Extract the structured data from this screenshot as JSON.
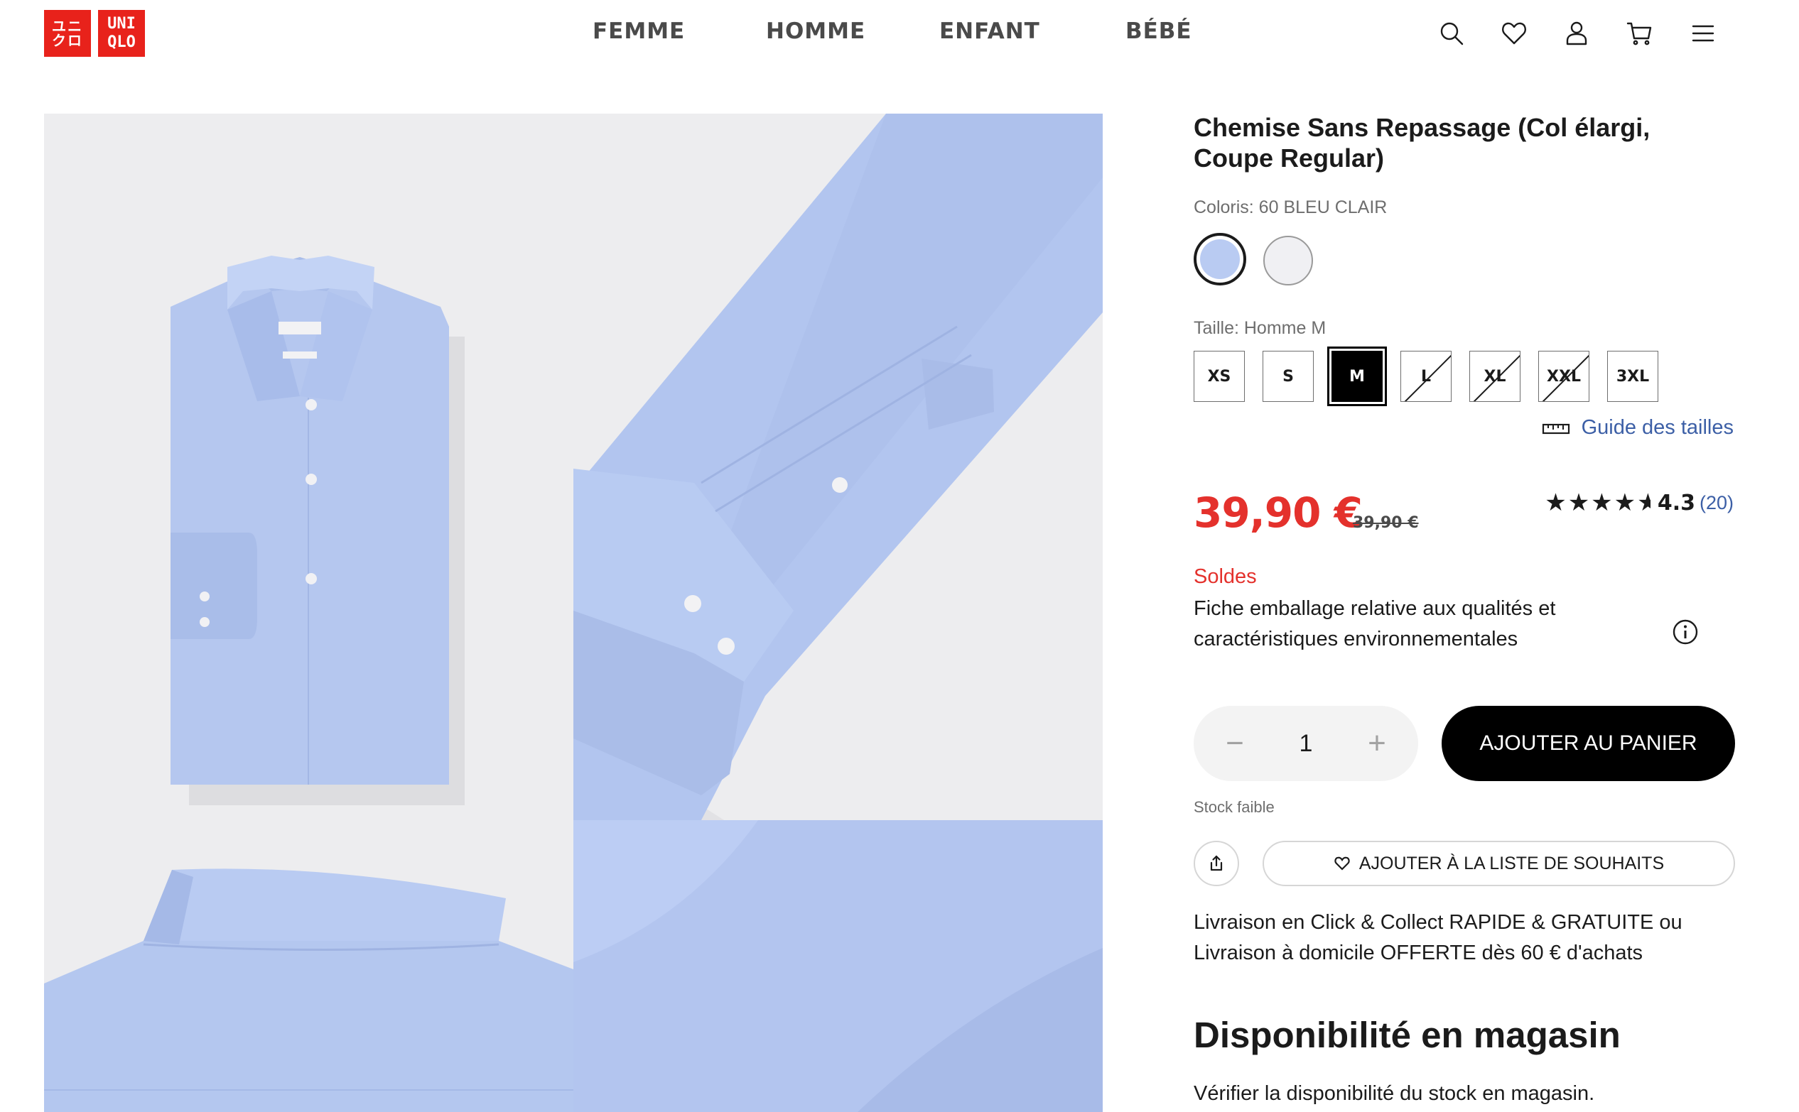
{
  "brand": {
    "logo_left_rows": [
      "ユニ",
      "クロ"
    ],
    "logo_right_rows": [
      "UNI",
      "QLO"
    ],
    "red": "#e8221b"
  },
  "nav": {
    "items": [
      "FEMME",
      "HOMME",
      "ENFANT",
      "BÉBÉ"
    ]
  },
  "header_icons": [
    "search-icon",
    "heart-icon",
    "account-icon",
    "cart-icon",
    "menu-icon"
  ],
  "product": {
    "title": "Chemise Sans Repassage (Col élargi, Coupe Regular)",
    "color_label": "Coloris: 60 BLEU CLAIR",
    "colors": [
      {
        "name": "60 BLEU CLAIR",
        "hex": "#b9cbf2",
        "selected": true
      },
      {
        "name": "white",
        "hex": "#f0f0f3",
        "selected": false
      }
    ],
    "size_label": "Taille: Homme M",
    "sizes": [
      {
        "label": "XS",
        "available": true,
        "selected": false
      },
      {
        "label": "S",
        "available": true,
        "selected": false
      },
      {
        "label": "M",
        "available": true,
        "selected": true
      },
      {
        "label": "L",
        "available": false,
        "selected": false
      },
      {
        "label": "XL",
        "available": false,
        "selected": false
      },
      {
        "label": "XXL",
        "available": false,
        "selected": false
      },
      {
        "label": "3XL",
        "available": true,
        "selected": false
      }
    ],
    "size_guide": "Guide des tailles",
    "price": "39,90 €",
    "old_price": "39,90 €",
    "price_color": "#e4312c",
    "rating": {
      "stars": "★★★★",
      "half_star": "★",
      "value": "4.3",
      "count": "(20)",
      "score": 4.3
    },
    "sale_label": "Soldes",
    "eco_text": "Fiche emballage relative aux qualités et caractéristiques environnementales",
    "quantity": {
      "minus": "−",
      "value": "1",
      "plus": "+"
    },
    "add_to_cart": "AJOUTER AU PANIER",
    "stock": "Stock faible",
    "wishlist": "AJOUTER À LA LISTE DE SOUHAITS",
    "delivery": "Livraison en Click & Collect RAPIDE & GRATUITE ou Livraison à domicile OFFERTE dès 60 € d'achats",
    "availability_title": "Disponibilité en magasin",
    "availability_sub": "Vérifier la disponibilité du stock en magasin."
  }
}
